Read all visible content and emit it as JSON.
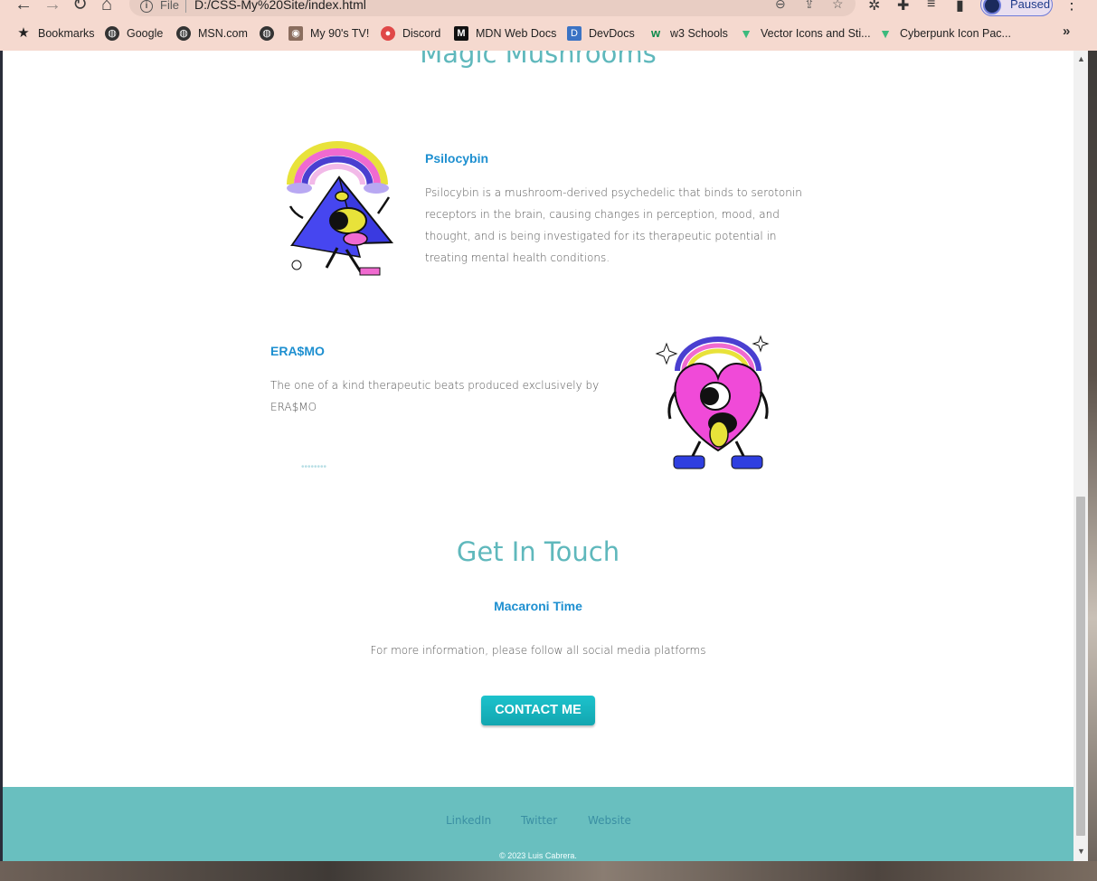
{
  "browser": {
    "omnibox_file": "File",
    "url": "D:/CSS-My%20Site/index.html",
    "profile_status": "Paused",
    "bookmarks": [
      {
        "label": "Bookmarks",
        "icon": "star-icon"
      },
      {
        "label": "Google",
        "icon": "globe-icon"
      },
      {
        "label": "MSN.com",
        "icon": "globe-icon"
      },
      {
        "label": "",
        "icon": "globe-icon"
      },
      {
        "label": "My 90's TV!",
        "icon": "tv-icon"
      },
      {
        "label": "Discord",
        "icon": "discord-icon"
      },
      {
        "label": "MDN Web Docs",
        "icon": "mdn-icon"
      },
      {
        "label": "DevDocs",
        "icon": "devdocs-icon"
      },
      {
        "label": "w3 Schools",
        "icon": "w3schools-icon"
      },
      {
        "label": "Vector Icons and Sti...",
        "icon": "vector-icon"
      },
      {
        "label": "Cyberpunk Icon Pac...",
        "icon": "vector-icon"
      }
    ],
    "more_bookmarks": "»"
  },
  "page": {
    "partial_section_title": "Magic Mushrooms",
    "cards": [
      {
        "title": "Psilocybin",
        "text": "Psilocybin is a mushroom-derived psychedelic that binds to serotonin receptors in the brain, causing changes in perception, mood, and thought, and is being investigated for its therapeutic potential in treating mental health conditions."
      },
      {
        "title": "ERA$MO",
        "text": "The one of a kind therapeutic beats produced exclusively by ERA$MO"
      }
    ],
    "pager": "••••••••",
    "contact": {
      "title": "Get In Touch",
      "subtitle": "Macaroni Time",
      "text": "For more information, please follow all social media platforms",
      "button": "CONTACT ME"
    },
    "footer": {
      "links": [
        "LinkedIn",
        "Twitter",
        "Website"
      ],
      "copyright": "© 2023 Luis Cabrera."
    }
  },
  "colors": {
    "accent": "#5fb8bc",
    "card_title": "#1d8fd0",
    "button": "#13a6b0",
    "footer_bg": "#69bfbf"
  }
}
